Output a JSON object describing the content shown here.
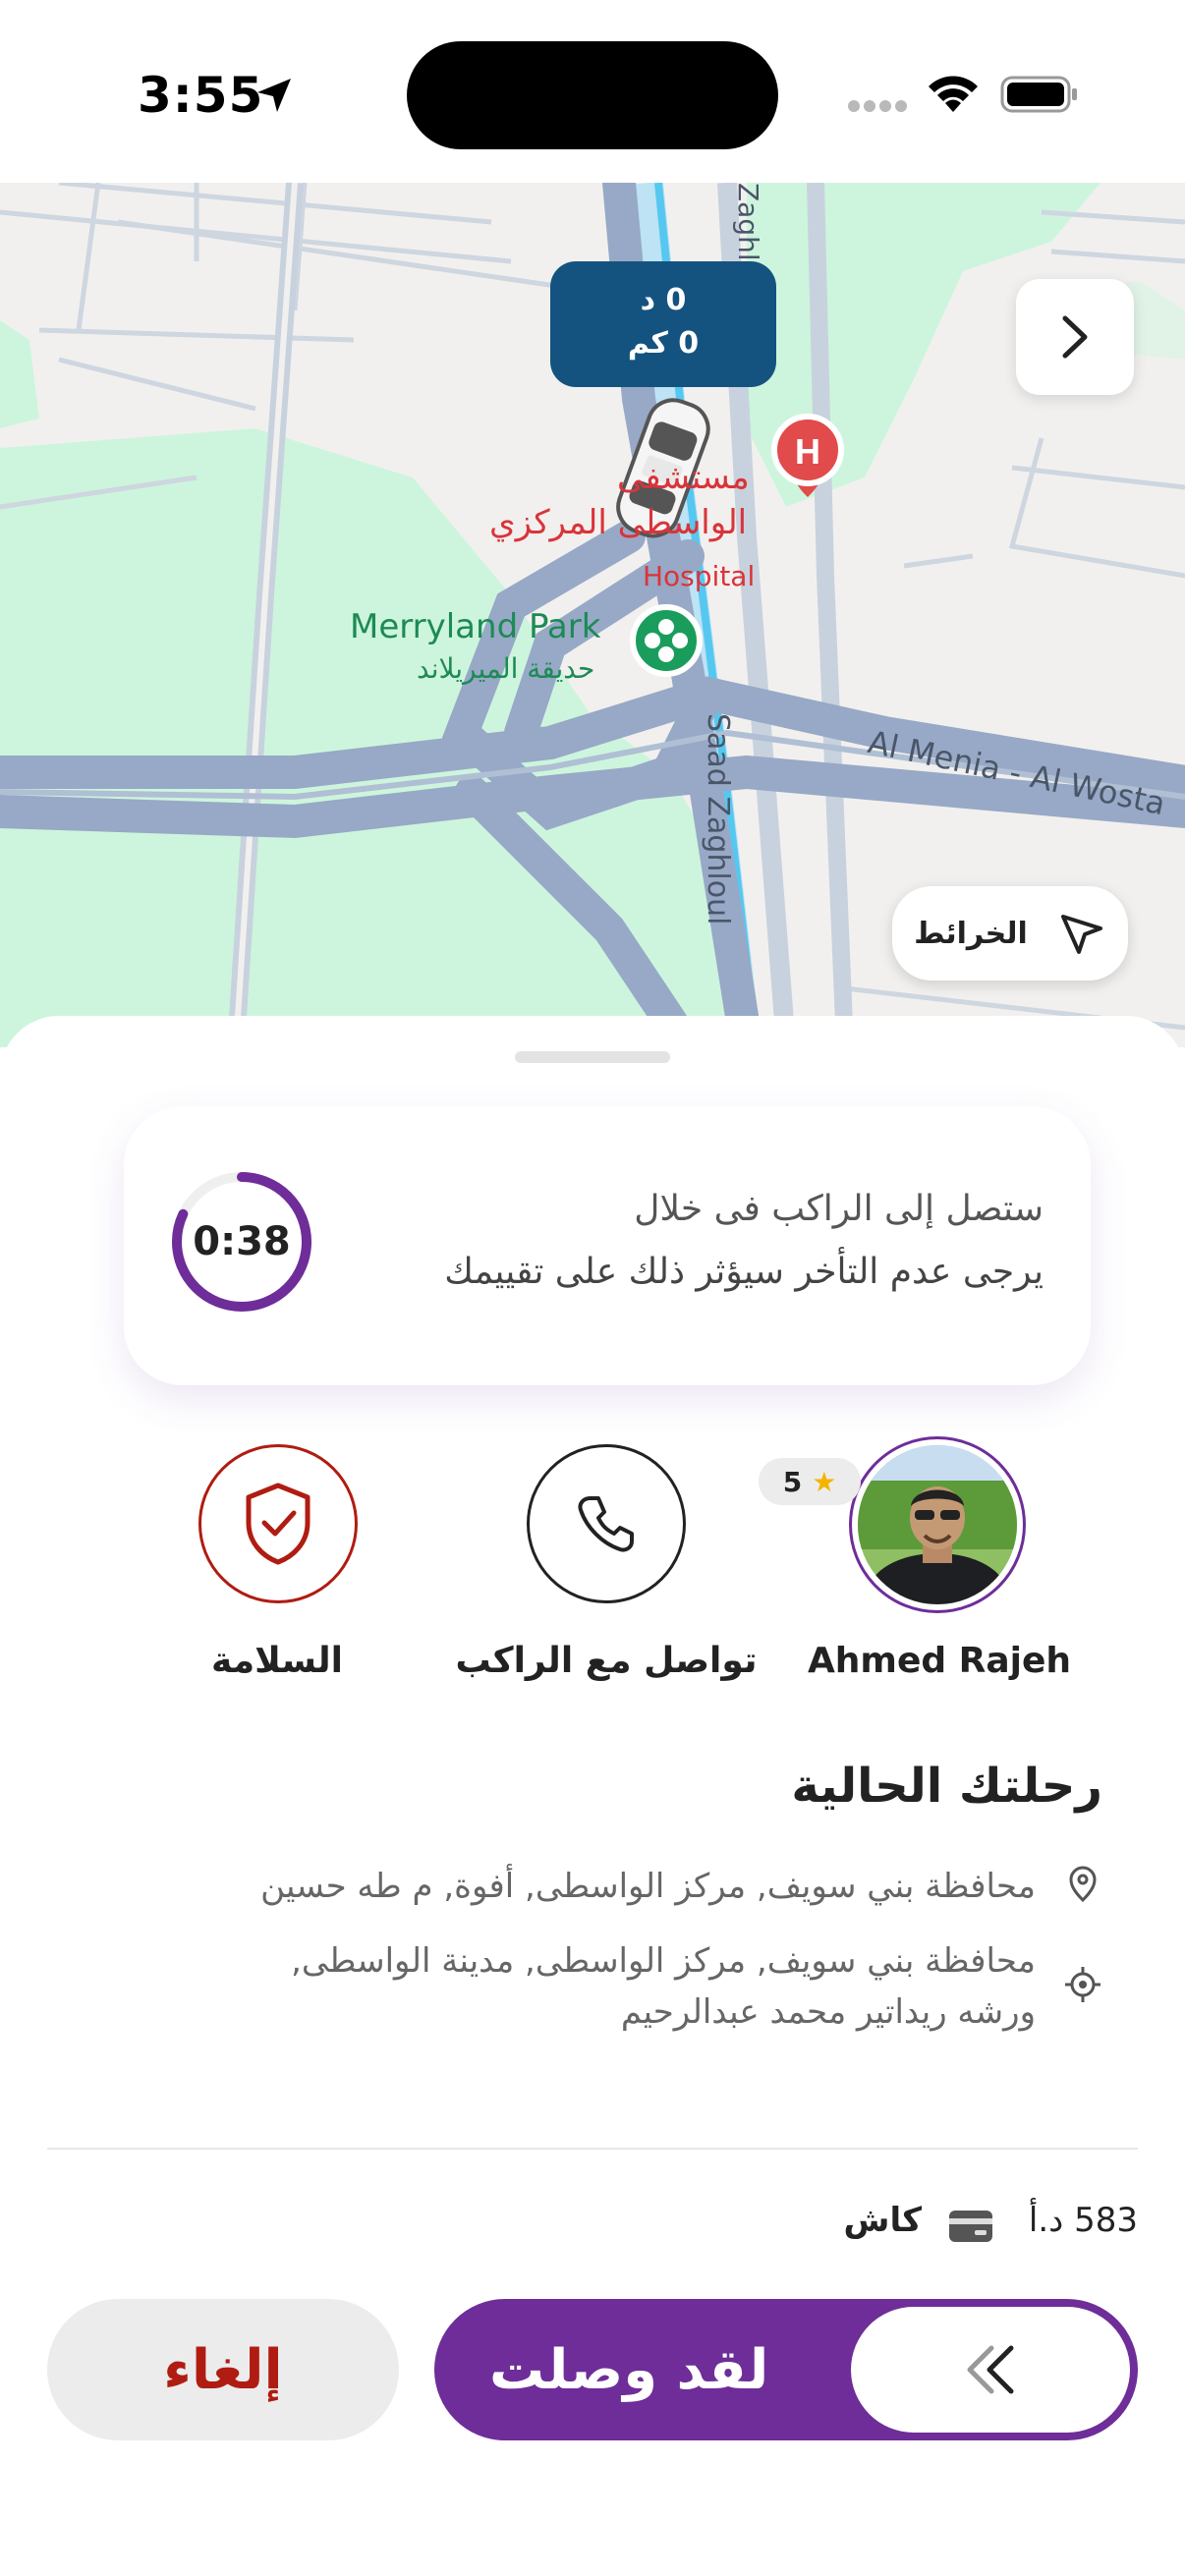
{
  "status_bar": {
    "time": "3:55"
  },
  "map": {
    "eta": {
      "minutes": "0 د",
      "distance": "0 كم"
    },
    "labels": {
      "hospital_ar_1": "مستشفى",
      "hospital_ar_2": "الواسطى المركزي",
      "hospital_en": "Hospital",
      "park_en": "Merryland Park",
      "park_ar": "حديقة الميريلاند",
      "street_saad": "Saad Zaghloul",
      "street_zaghlo": "Zaghlo",
      "street_menia": "Al Menia - Al Wosta"
    },
    "maps_button_label": "الخرائط"
  },
  "timer_card": {
    "countdown": "0:38",
    "countdown_progress": 0.82,
    "line1": "ستصل إلى الراكب فى خلال",
    "line2": "يرجى عدم التأخر سيؤثر ذلك على تقييمك"
  },
  "actions": {
    "safety_label": "السلامة",
    "contact_label": "تواصل مع الراكب",
    "rider_name": "Ahmed Rajeh",
    "rider_rating": "5"
  },
  "trip": {
    "title": "رحلتك الحالية",
    "pickup": "محافظة بني سويف, مركز الواسطى, أفوة, م طه حسين",
    "dropoff_line1": "محافظة بني سويف, مركز الواسطى, مدينة الواسطى,",
    "dropoff_line2": "ورشه ريداتير محمد عبدالرحيم"
  },
  "payment": {
    "price": "583 د.أ",
    "method": "كاش"
  },
  "buttons": {
    "cancel": "إلغاء",
    "arrived": "لقد وصلت"
  },
  "colors": {
    "primary_purple": "#6e2d99",
    "eta_blue": "#145380",
    "danger_red": "#b01c12",
    "park_green": "#cdf5dd",
    "road_blue": "#97a9c6"
  }
}
